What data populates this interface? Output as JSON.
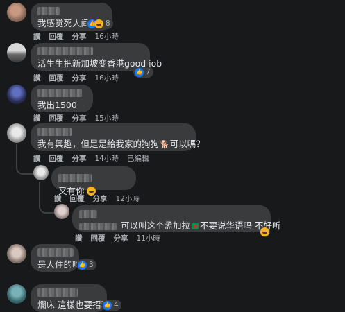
{
  "actions": {
    "like": "讚",
    "reply": "回覆",
    "share": "分享",
    "edited": "已編輯"
  },
  "comments": [
    {
      "text": "我感觉死人间",
      "time": "16小時",
      "reactions": "8"
    },
    {
      "text": "活生生把新加坡变香港good job",
      "time": "16小時",
      "reactions": "7"
    },
    {
      "text": "我出1500",
      "time": "15小時"
    },
    {
      "text_before": "我有興趣，但是是給我家的狗狗",
      "text_after": "可以嗎？",
      "time": "14小時"
    },
    {
      "text": "又有你",
      "time": "12小時"
    },
    {
      "text_before": "可以叫这个孟加拉",
      "text_after": "不要说华语吗 不好听",
      "time": "11小時"
    },
    {
      "text": "是人住的吗",
      "reactions": "3"
    },
    {
      "text": "爛床 這樣也要招租",
      "reactions": "4"
    }
  ],
  "icons": {
    "like": "like-icon",
    "haha": "haha-icon",
    "laugh": "laugh-emoji",
    "dog": "dog-emoji",
    "flag": "bangladesh-flag-emoji"
  },
  "colors": {
    "background": "#18191a",
    "bubble": "#3a3b3c",
    "text": "#e4e6eb",
    "meta": "#b0b3b8",
    "like": "#1877f2"
  }
}
